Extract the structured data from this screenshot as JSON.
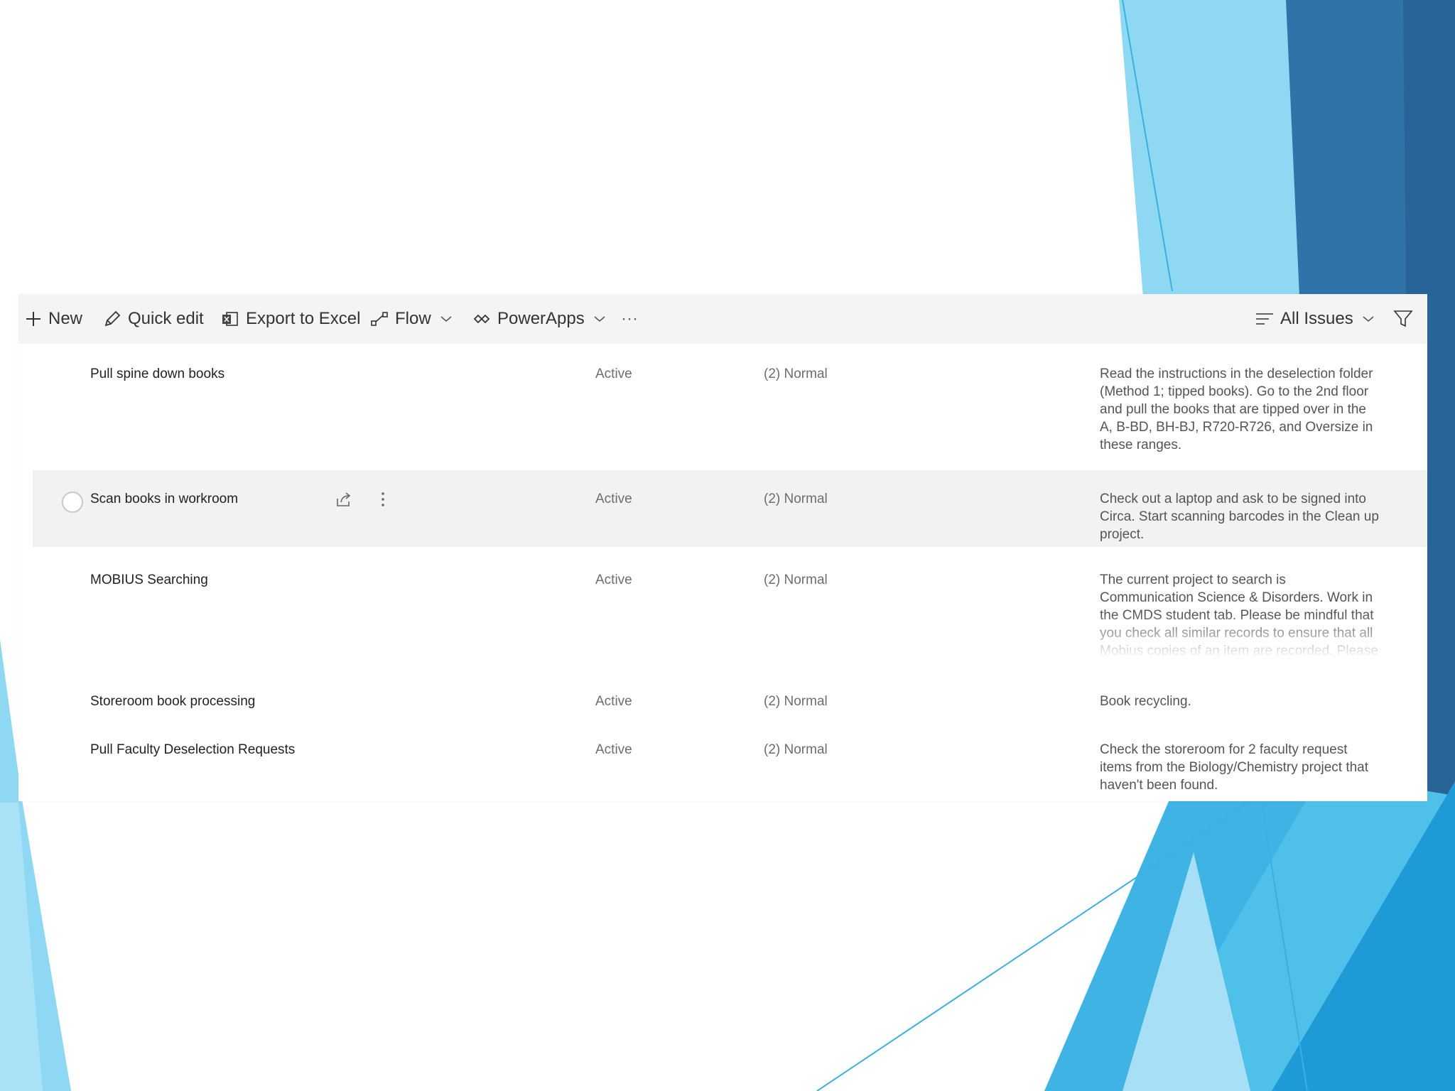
{
  "colors": {
    "accent_light": "#8fd8f3",
    "accent_mid": "#3bb0e0",
    "accent_dark": "#2a6fa3",
    "toolbar_bg": "#f4f4f4",
    "row_hover_bg": "#f2f2f2"
  },
  "toolbar": {
    "new_label": "New",
    "quick_edit_label": "Quick edit",
    "export_label": "Export to Excel",
    "flow_label": "Flow",
    "powerapps_label": "PowerApps",
    "more_label": "···",
    "view_label": "All Issues"
  },
  "rows": [
    {
      "title": "Pull spine down books",
      "status": "Active",
      "priority": "(2) Normal",
      "description": "Read the instructions in the deselection folder (Method 1; tipped books). Go to the 2nd floor and pull the books that are tipped over in the A, B-BD, BH-BJ, R720-R726, and Oversize in these ranges."
    },
    {
      "title": "Scan books in workroom",
      "status": "Active",
      "priority": "(2) Normal",
      "description": "Check out a laptop and ask to be signed into Circa. Start scanning barcodes in the Clean up project."
    },
    {
      "title": "MOBIUS Searching",
      "status": "Active",
      "priority": "(2) Normal",
      "description": "The current project to search is Communication Science & Disorders. Work in the CMDS student tab. Please be mindful that you check all similar records to ensure that all Mobius copies of an item are recorded. Please"
    },
    {
      "title": "Storeroom book processing",
      "status": "Active",
      "priority": "(2) Normal",
      "description": "Book recycling."
    },
    {
      "title": "Pull Faculty Deselection Requests",
      "status": "Active",
      "priority": "(2) Normal",
      "description": "Check the storeroom for 2 faculty request items from the Biology/Chemistry project that haven't been found."
    }
  ]
}
